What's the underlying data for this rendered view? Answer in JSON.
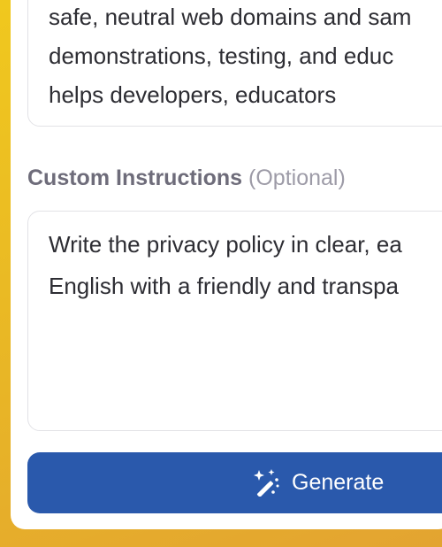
{
  "description_field": {
    "lines": "safe, neutral web domains and sam\ndemonstrations, testing, and educ\nhelps developers, educators"
  },
  "custom_instructions": {
    "label": "Custom Instructions",
    "optional_label": "(Optional)",
    "value": "Write the privacy policy in clear, ea\nEnglish with a friendly and transpa"
  },
  "generate_button": {
    "label": "Generate",
    "icon": "magic-wand-icon"
  },
  "colors": {
    "primary": "#2a59ac",
    "frame": "#e8b526",
    "label": "#6e6c7a",
    "optional": "#9d9ba7"
  }
}
